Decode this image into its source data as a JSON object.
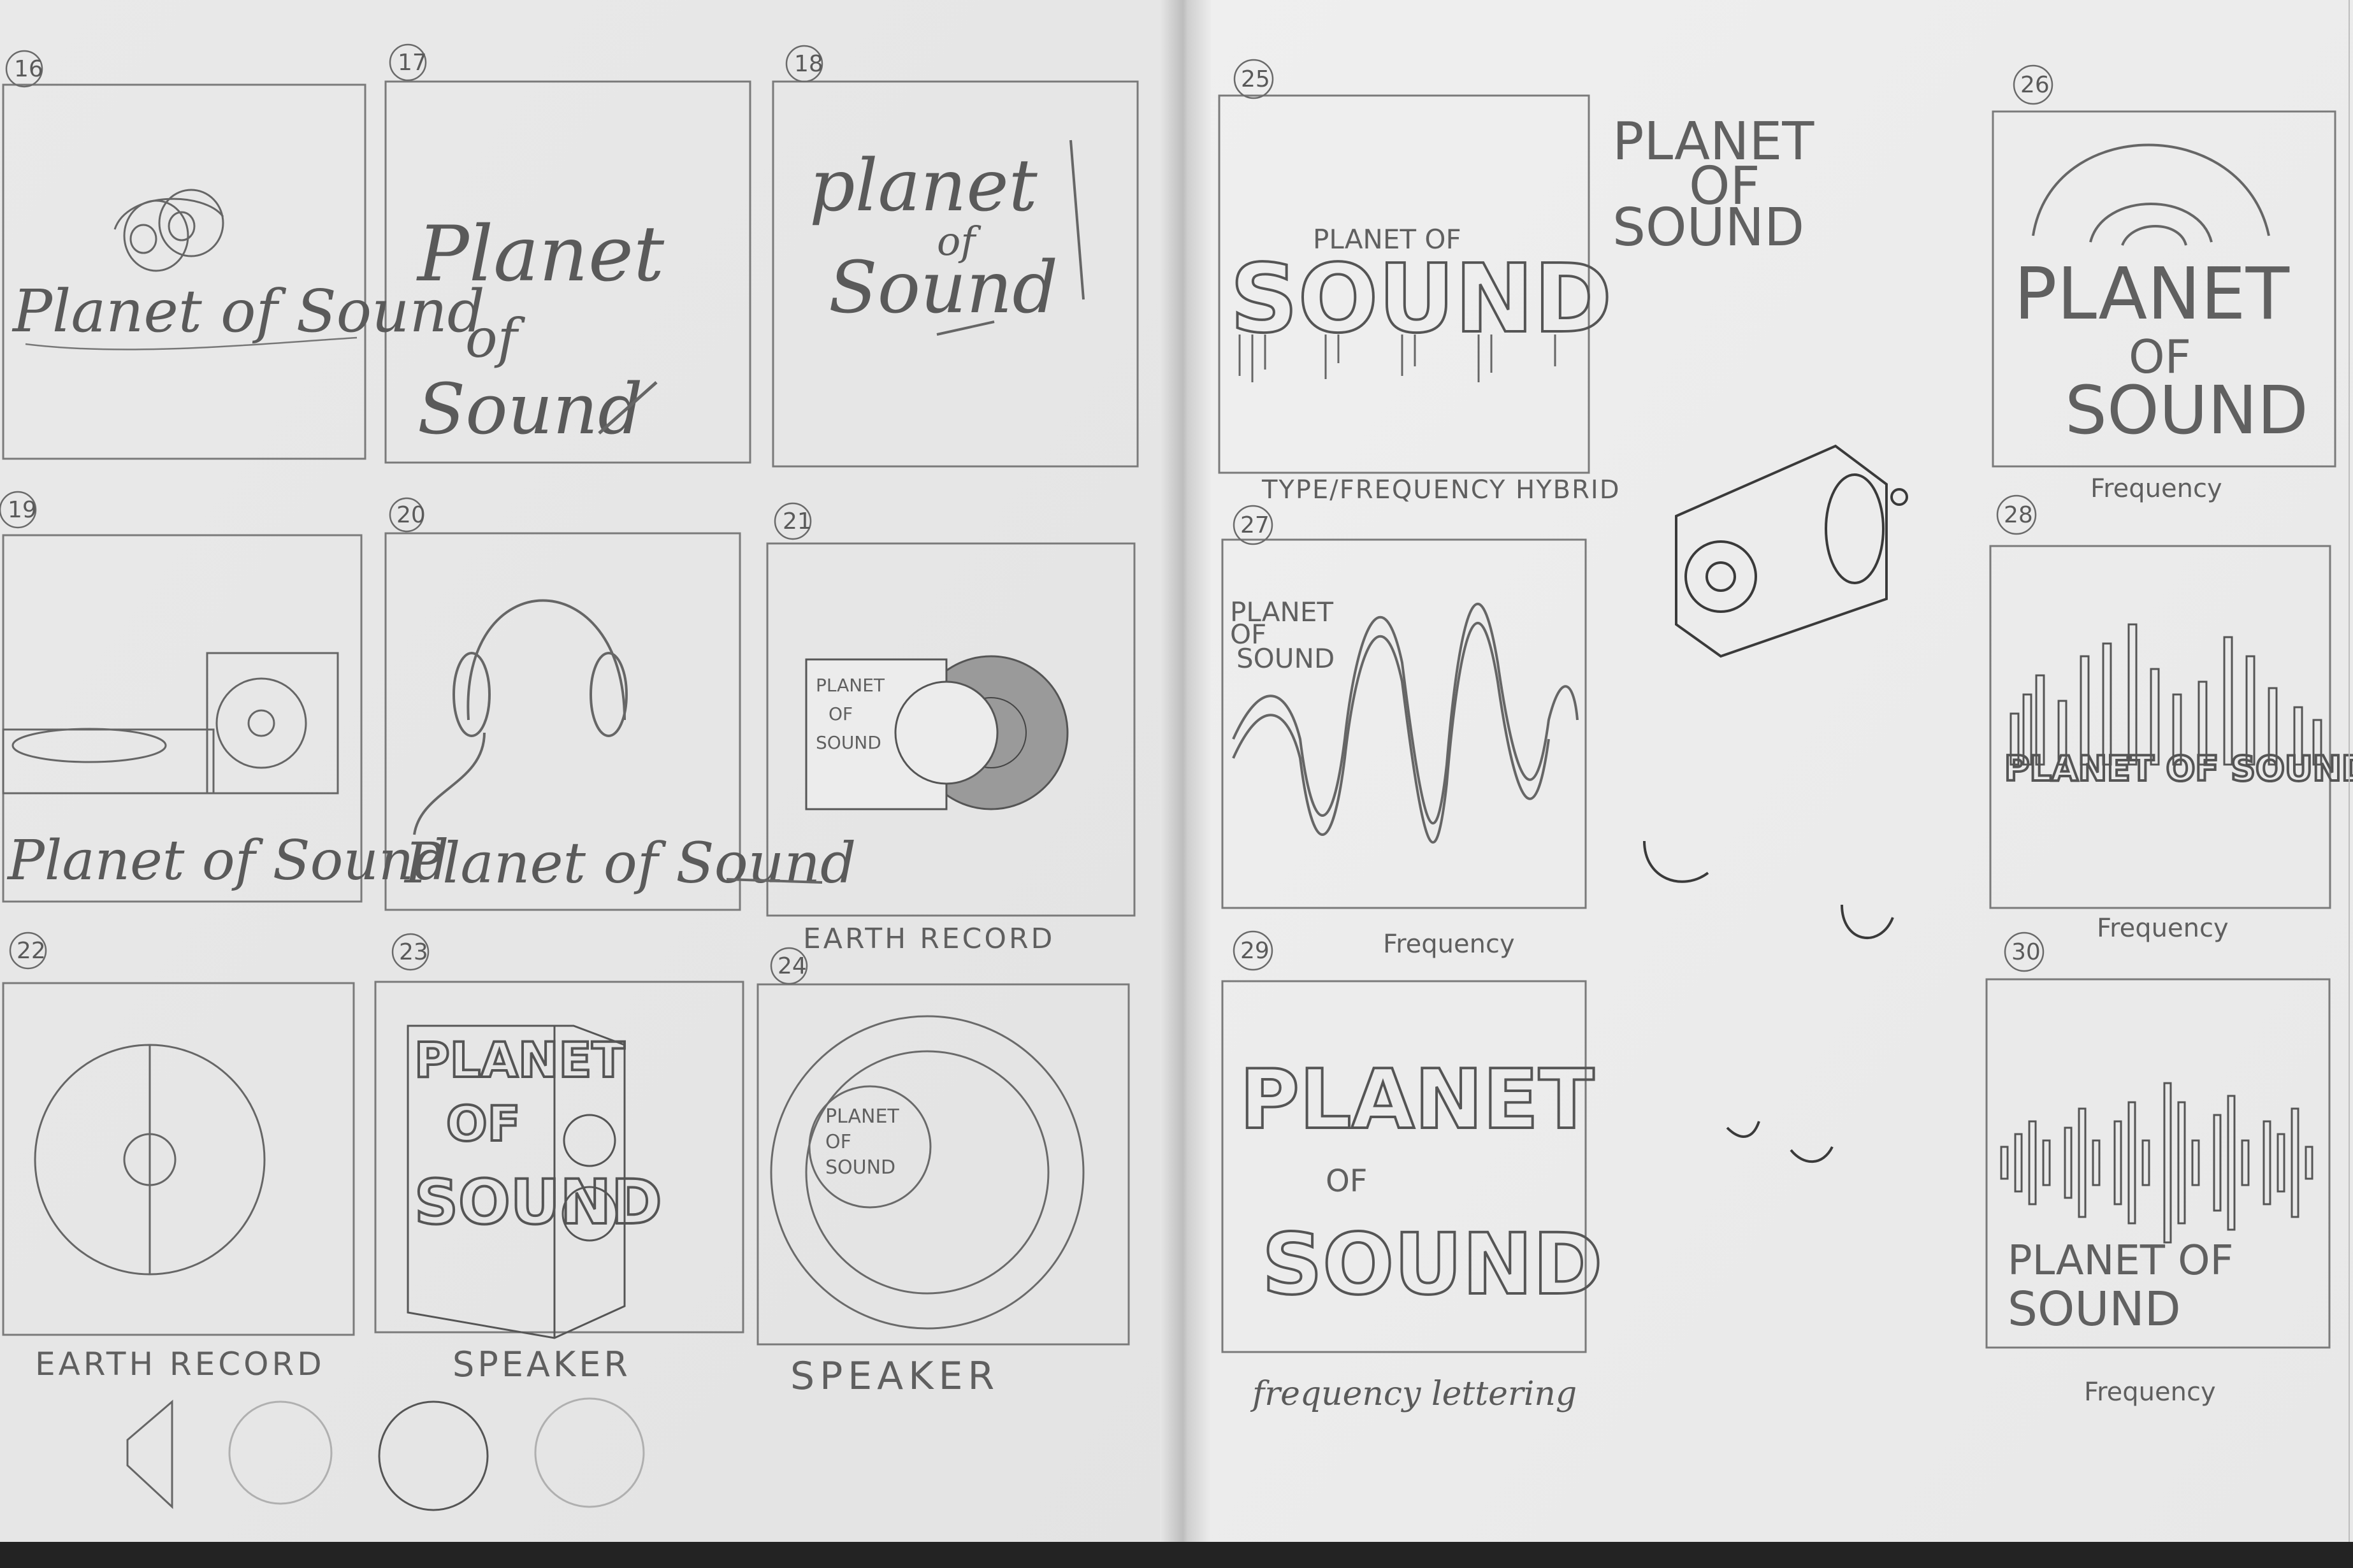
{
  "colors": {
    "paper_left": "#ededed",
    "paper_right": "#f0f0f0",
    "pencil": "#555555",
    "shadow": "#1e1e1e"
  },
  "left_page": {
    "sketches": [
      {
        "number": "16",
        "text": "Planet of Sound",
        "caption": ""
      },
      {
        "number": "17",
        "text_lines": [
          "Planet",
          "of",
          "Sound"
        ],
        "caption": ""
      },
      {
        "number": "18",
        "text_lines": [
          "planet",
          "of",
          "Sound"
        ],
        "caption": ""
      },
      {
        "number": "19",
        "text": "Planet of Sound",
        "caption": ""
      },
      {
        "number": "20",
        "text": "Planet of Sound",
        "caption": ""
      },
      {
        "number": "21",
        "text_lines": [
          "PLANET",
          "OF",
          "SOUND"
        ],
        "caption": "EARTH RECORD"
      },
      {
        "number": "22",
        "caption": "EARTH RECORD"
      },
      {
        "number": "23",
        "text_lines": [
          "PLANET",
          "OF",
          "SOUND"
        ],
        "caption": "SPEAKER"
      },
      {
        "number": "24",
        "text_lines": [
          "PLANET",
          "OF",
          "SOUND"
        ],
        "caption": "SPEAKER"
      }
    ]
  },
  "right_page": {
    "sketches": [
      {
        "number": "25",
        "text_lines": [
          "PLANET OF",
          "SOUND"
        ],
        "caption": "TYPE/FREQUENCY HYBRID"
      },
      {
        "number": "26",
        "text_lines": [
          "PLANET",
          "OF",
          "SOUND"
        ],
        "caption": "Frequency"
      },
      {
        "number": "27",
        "text_lines": [
          "PLANET",
          "OF",
          "SOUND"
        ],
        "caption": "Frequency"
      },
      {
        "number": "28",
        "text": "PLANET OF SOUND",
        "caption": "Frequency"
      },
      {
        "number": "29",
        "text_lines": [
          "PLANET",
          "OF",
          "SOUND"
        ],
        "caption": "frequency lettering"
      },
      {
        "number": "30",
        "text_lines": [
          "PLANET OF",
          "SOUND"
        ],
        "caption": "Frequency"
      }
    ],
    "free_title": [
      "PLANET",
      "OF",
      "SOUND"
    ]
  }
}
